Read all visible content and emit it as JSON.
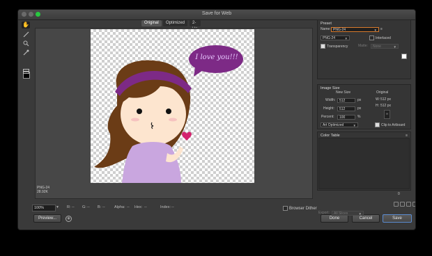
{
  "window": {
    "title": "Save for Web"
  },
  "tabs": [
    {
      "label": "Original",
      "selected": true
    },
    {
      "label": "Optimized",
      "selected": false
    },
    {
      "label": "2-Up",
      "selected": false
    }
  ],
  "toolbar": {
    "tools": [
      "hand-tool-icon",
      "slice-select-tool-icon",
      "zoom-tool-icon",
      "eyedropper-tool-icon",
      "eyedropper-color-swatch",
      "toggle-slices-icon"
    ],
    "swatch_color": "#000000"
  },
  "image": {
    "bubble_text": "I love you!!!",
    "format_line": "PNG-24",
    "size_line": "28.92K"
  },
  "status": {
    "zoom": "100%",
    "r_label": "R:",
    "r_value": "--",
    "g_label": "G:",
    "g_value": "--",
    "b_label": "B:",
    "b_value": "--",
    "alpha_label": "Alpha:",
    "alpha_value": "--",
    "hex_label": "Hex:",
    "hex_value": "--",
    "index_label": "Index:",
    "index_value": "--",
    "browser_dither": "Browser Dither"
  },
  "buttons": {
    "preview": "Preview...",
    "done": "Done",
    "cancel": "Cancel",
    "save": "Save"
  },
  "preset": {
    "header": "Preset",
    "name_label": "Name:",
    "name_value": "PNG-24",
    "format_value": "PNG-24",
    "interlaced": "Interlaced",
    "transparency": "Transparency",
    "matte_label": "Matte:",
    "matte_value": "None"
  },
  "image_size": {
    "header": "Image Size",
    "new_size": "New Size",
    "original": "Original",
    "width_label": "Width:",
    "width_value": "512",
    "height_label": "Height:",
    "height_value": "512",
    "percent_label": "Percent:",
    "percent_value": "100",
    "unit_px": "px",
    "unit_pct": "%",
    "orig_w_label": "W:",
    "orig_w_value": "512 px",
    "orig_h_label": "H:",
    "orig_h_value": "512 px",
    "quality_value": "Art Optimized",
    "clip_to_artboard": "Clip to Artboard"
  },
  "color_table": {
    "header": "Color Table",
    "count": "0",
    "export_label": "Export:",
    "export_value": "All Slices"
  },
  "colors": {
    "accent_orange": "#d87a2c",
    "bubble_purple": "#7d2a86",
    "hair_brown": "#6b3c16",
    "dress_lilac": "#c9a6df"
  }
}
